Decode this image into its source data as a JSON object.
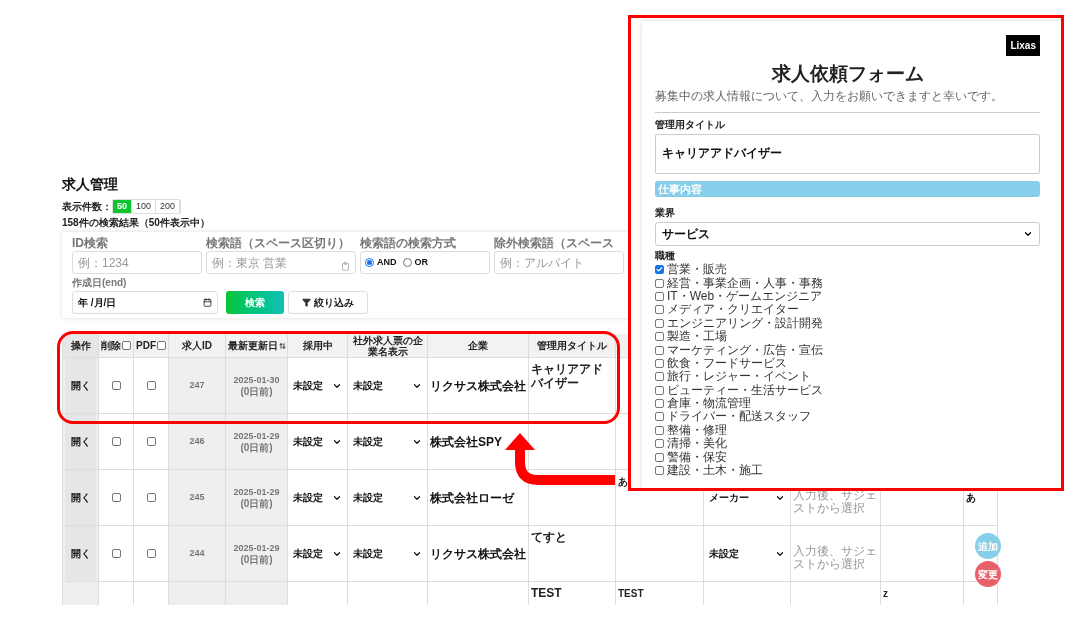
{
  "page": {
    "title": "求人管理",
    "per_page": {
      "label": "表示件数：",
      "options": [
        {
          "label": "50",
          "selected": true
        },
        {
          "label": "100",
          "selected": false
        },
        {
          "label": "200",
          "selected": false
        }
      ]
    },
    "result_summary": "158件の検索結果（50件表示中）"
  },
  "filters": {
    "fields": [
      {
        "kind": "text",
        "label": "ID検索",
        "placeholder": "例：1234"
      },
      {
        "kind": "text_icon",
        "label": "検索語（スペース区切り）",
        "placeholder": "例：東京 営業"
      },
      {
        "kind": "radio",
        "label": "検索語の検索方式",
        "options": [
          {
            "label": "AND",
            "selected": true
          },
          {
            "label": "OR",
            "selected": false
          }
        ]
      },
      {
        "kind": "text",
        "label": "除外検索語（スペース",
        "placeholder": "例：アルバイト"
      }
    ],
    "date": {
      "label": "作成日(end)",
      "value": "年 /月/日"
    },
    "buttons": [
      {
        "kind": "primary",
        "label": "検索"
      },
      {
        "kind": "filter",
        "label": "絞り込み"
      }
    ]
  },
  "table": {
    "columns": [
      {
        "kind": "plain",
        "label": "操作"
      },
      {
        "kind": "checkbox",
        "label": "削除",
        "checked": false
      },
      {
        "kind": "checkbox",
        "label": "PDF",
        "checked": false
      },
      {
        "kind": "plain",
        "label": "求人ID"
      },
      {
        "kind": "sort",
        "label": "最新更新日"
      },
      {
        "kind": "plain",
        "label": "採用中"
      },
      {
        "kind": "plain",
        "label": "社外求人票の企業名表示"
      },
      {
        "kind": "plain",
        "label": "企業"
      },
      {
        "kind": "plain",
        "label": "管理用タイトル"
      }
    ],
    "rows": [
      {
        "action": "開く",
        "delete": false,
        "pdf": false,
        "id": "247",
        "updated": "2025-01-30",
        "ago": "(0日前)",
        "hiring": "未設定",
        "company_display": "未設定",
        "company": "リクサス株式会社",
        "title": "キャリアアドバイザー"
      },
      {
        "action": "開く",
        "delete": false,
        "pdf": false,
        "id": "246",
        "updated": "2025-01-29",
        "ago": "(0日前)",
        "hiring": "未設定",
        "company_display": "未設定",
        "company": "株式会社SPY"
      },
      {
        "action": "開く",
        "delete": false,
        "pdf": false,
        "id": "245",
        "updated": "2025-01-29",
        "ago": "(0日前)",
        "hiring": "未設定",
        "company_display": "未設定",
        "company": "株式会社ローゼ",
        "column_10": "あ",
        "column_11": "メーカー",
        "column_12": {
          "placeholder": "入力後、サジェストから選択"
        },
        "column_14": "あ"
      },
      {
        "action": "開く",
        "delete": false,
        "pdf": false,
        "id": "244",
        "updated": "2025-01-29",
        "ago": "(0日前)",
        "hiring": "未設定",
        "company_display": "未設定",
        "company": "リクサス株式会社",
        "title": "てすと",
        "column_11": "未設定",
        "column_12": {
          "placeholder": "入力後、サジェストから選択"
        }
      },
      {
        "title": "TEST",
        "column_10": "TEST",
        "column_13": "z"
      }
    ]
  },
  "floating_buttons": [
    {
      "kind": "add",
      "label": "追加"
    },
    {
      "kind": "change",
      "label": "変更"
    }
  ],
  "form": {
    "logo": "Lixas",
    "title": "求人依頼フォーム",
    "description": "募集中の求人情報について、入力をお願いできますと幸いです。",
    "title_field": {
      "label": "管理用タイトル",
      "value": "キャリアアドバイザー"
    },
    "section": "仕事内容",
    "industry": {
      "label": "業界",
      "value": "サービス"
    },
    "occupation": {
      "label": "職種",
      "options": [
        {
          "label": "営業・販売",
          "checked": true
        },
        {
          "label": "経営・事業企画・人事・事務",
          "checked": false
        },
        {
          "label": "IT・Web・ゲームエンジニア",
          "checked": false
        },
        {
          "label": "メディア・クリエイター",
          "checked": false
        },
        {
          "label": "エンジニアリング・設計開発",
          "checked": false
        },
        {
          "label": "製造・工場",
          "checked": false
        },
        {
          "label": "マーケティング・広告・宣伝",
          "checked": false
        },
        {
          "label": "飲食・フードサービス",
          "checked": false
        },
        {
          "label": "旅行・レジャー・イベント",
          "checked": false
        },
        {
          "label": "ビューティー・生活サービス",
          "checked": false
        },
        {
          "label": "倉庫・物流管理",
          "checked": false
        },
        {
          "label": "ドライバー・配送スタッフ",
          "checked": false
        },
        {
          "label": "整備・修理",
          "checked": false
        },
        {
          "label": "清掃・美化",
          "checked": false
        },
        {
          "label": "警備・保安",
          "checked": false
        },
        {
          "label": "建設・土木・施工",
          "checked": false
        }
      ]
    }
  }
}
